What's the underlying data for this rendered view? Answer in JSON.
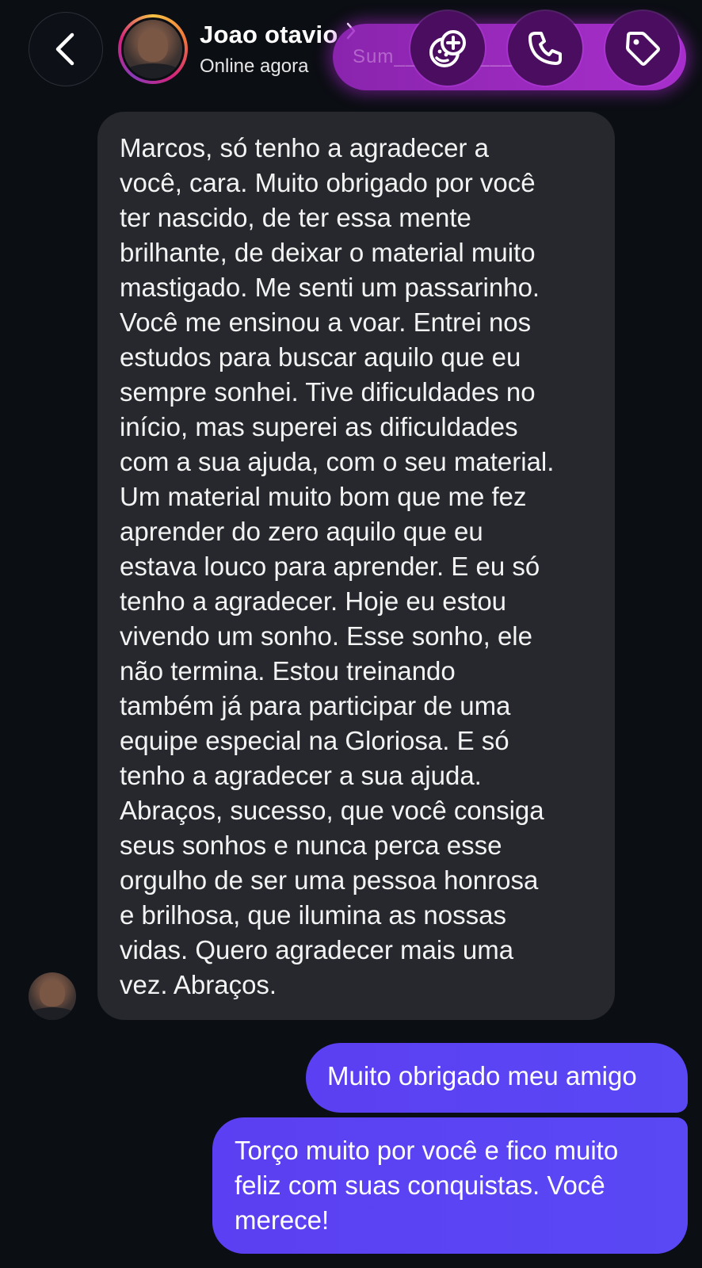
{
  "header": {
    "contact_name": "Joao otavio",
    "status": "Online agora",
    "action_hint": "Sum___ ___ç___ra",
    "icons": {
      "back": "chevron-left-icon",
      "name_chevron": "chevron-right-icon",
      "sticker": "sticker-add-icon",
      "call": "phone-icon",
      "tag": "tag-icon"
    }
  },
  "conversation": {
    "incoming": [
      {
        "text": "Marcos, só tenho a agradecer a\nvocê, cara. Muito obrigado por você\nter nascido, de ter essa mente\nbrilhante, de deixar o material muito\nmastigado. Me senti um passarinho.\nVocê me ensinou a voar. Entrei nos\nestudos para buscar aquilo que eu\nsempre sonhei. Tive dificuldades no\ninício, mas superei as dificuldades\ncom a sua ajuda, com o seu material.\nUm material muito bom que me fez\naprender do zero aquilo que eu\nestava louco para aprender. E eu só\ntenho a agradecer. Hoje eu estou\nvivendo um sonho. Esse sonho, ele\nnão termina. Estou treinando\ntambém já para participar de uma\nequipe especial na Gloriosa. E só\ntenho a agradecer a sua ajuda.\nAbraços, sucesso, que você consiga\nseus sonhos e nunca perca esse\norgulho de ser uma pessoa honrosa\ne brilhosa, que ilumina as nossas\nvidas. Quero agradecer mais uma\nvez. Abraços."
      }
    ],
    "outgoing": [
      {
        "text": "Muito obrigado meu amigo"
      },
      {
        "text": "Torço muito por você e fico muito\nfeliz com suas conquistas. Você\nmerece!"
      }
    ]
  },
  "colors": {
    "background": "#0b0e13",
    "incoming_bubble": "#26282d",
    "outgoing_bubble": "#5a45f3",
    "action_bar": "#b030d6",
    "action_button": "#4a0d5f"
  }
}
